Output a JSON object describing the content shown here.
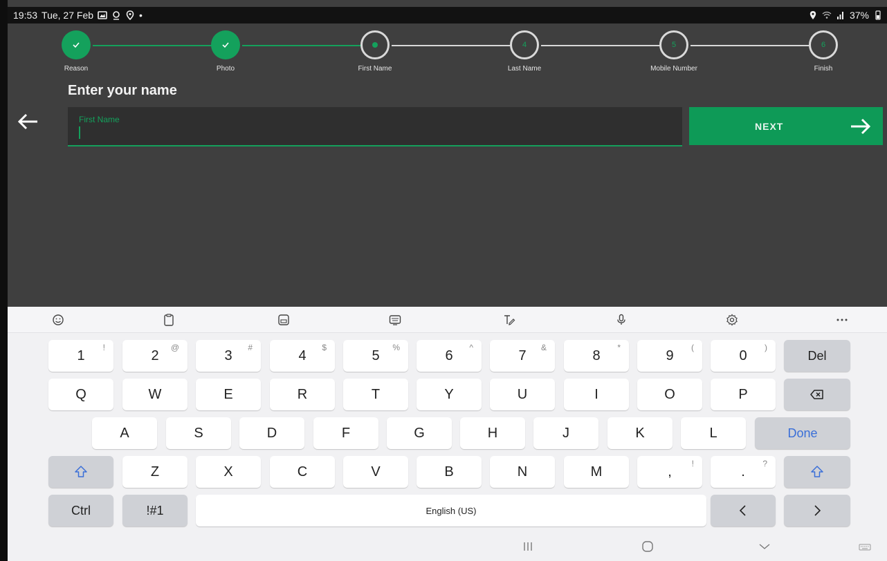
{
  "status_bar": {
    "time": "19:53",
    "date": "Tue, 27 Feb",
    "dot": "•",
    "battery": "37%"
  },
  "stepper": {
    "steps": [
      {
        "label": "Reason",
        "state": "done"
      },
      {
        "label": "Photo",
        "state": "done"
      },
      {
        "label": "First Name",
        "state": "active"
      },
      {
        "label": "Last Name",
        "state": "todo",
        "number": "4"
      },
      {
        "label": "Mobile Number",
        "state": "todo",
        "number": "5"
      },
      {
        "label": "Finish",
        "state": "todo",
        "number": "6"
      }
    ]
  },
  "form": {
    "title": "Enter your name",
    "field_label": "First Name",
    "field_value": "",
    "next_label": "NEXT"
  },
  "keyboard": {
    "row1": [
      {
        "main": "1",
        "sub": "!"
      },
      {
        "main": "2",
        "sub": "@"
      },
      {
        "main": "3",
        "sub": "#"
      },
      {
        "main": "4",
        "sub": "$"
      },
      {
        "main": "5",
        "sub": "%"
      },
      {
        "main": "6",
        "sub": "^"
      },
      {
        "main": "7",
        "sub": "&"
      },
      {
        "main": "8",
        "sub": "*"
      },
      {
        "main": "9",
        "sub": "("
      },
      {
        "main": "0",
        "sub": ")"
      }
    ],
    "del_label": "Del",
    "row2": [
      "Q",
      "W",
      "E",
      "R",
      "T",
      "Y",
      "U",
      "I",
      "O",
      "P"
    ],
    "row3": [
      "A",
      "S",
      "D",
      "F",
      "G",
      "H",
      "J",
      "K",
      "L"
    ],
    "done_label": "Done",
    "row4": [
      "Z",
      "X",
      "C",
      "V",
      "B",
      "N",
      "M"
    ],
    "comma": {
      "main": ",",
      "sub": "!"
    },
    "period": {
      "main": ".",
      "sub": "?"
    },
    "ctrl_label": "Ctrl",
    "symbols_label": "!#1",
    "space_label": "English (US)"
  },
  "colors": {
    "accent": "#14a15c",
    "background": "#3f3f3f",
    "done_text": "#3a6fd8"
  }
}
